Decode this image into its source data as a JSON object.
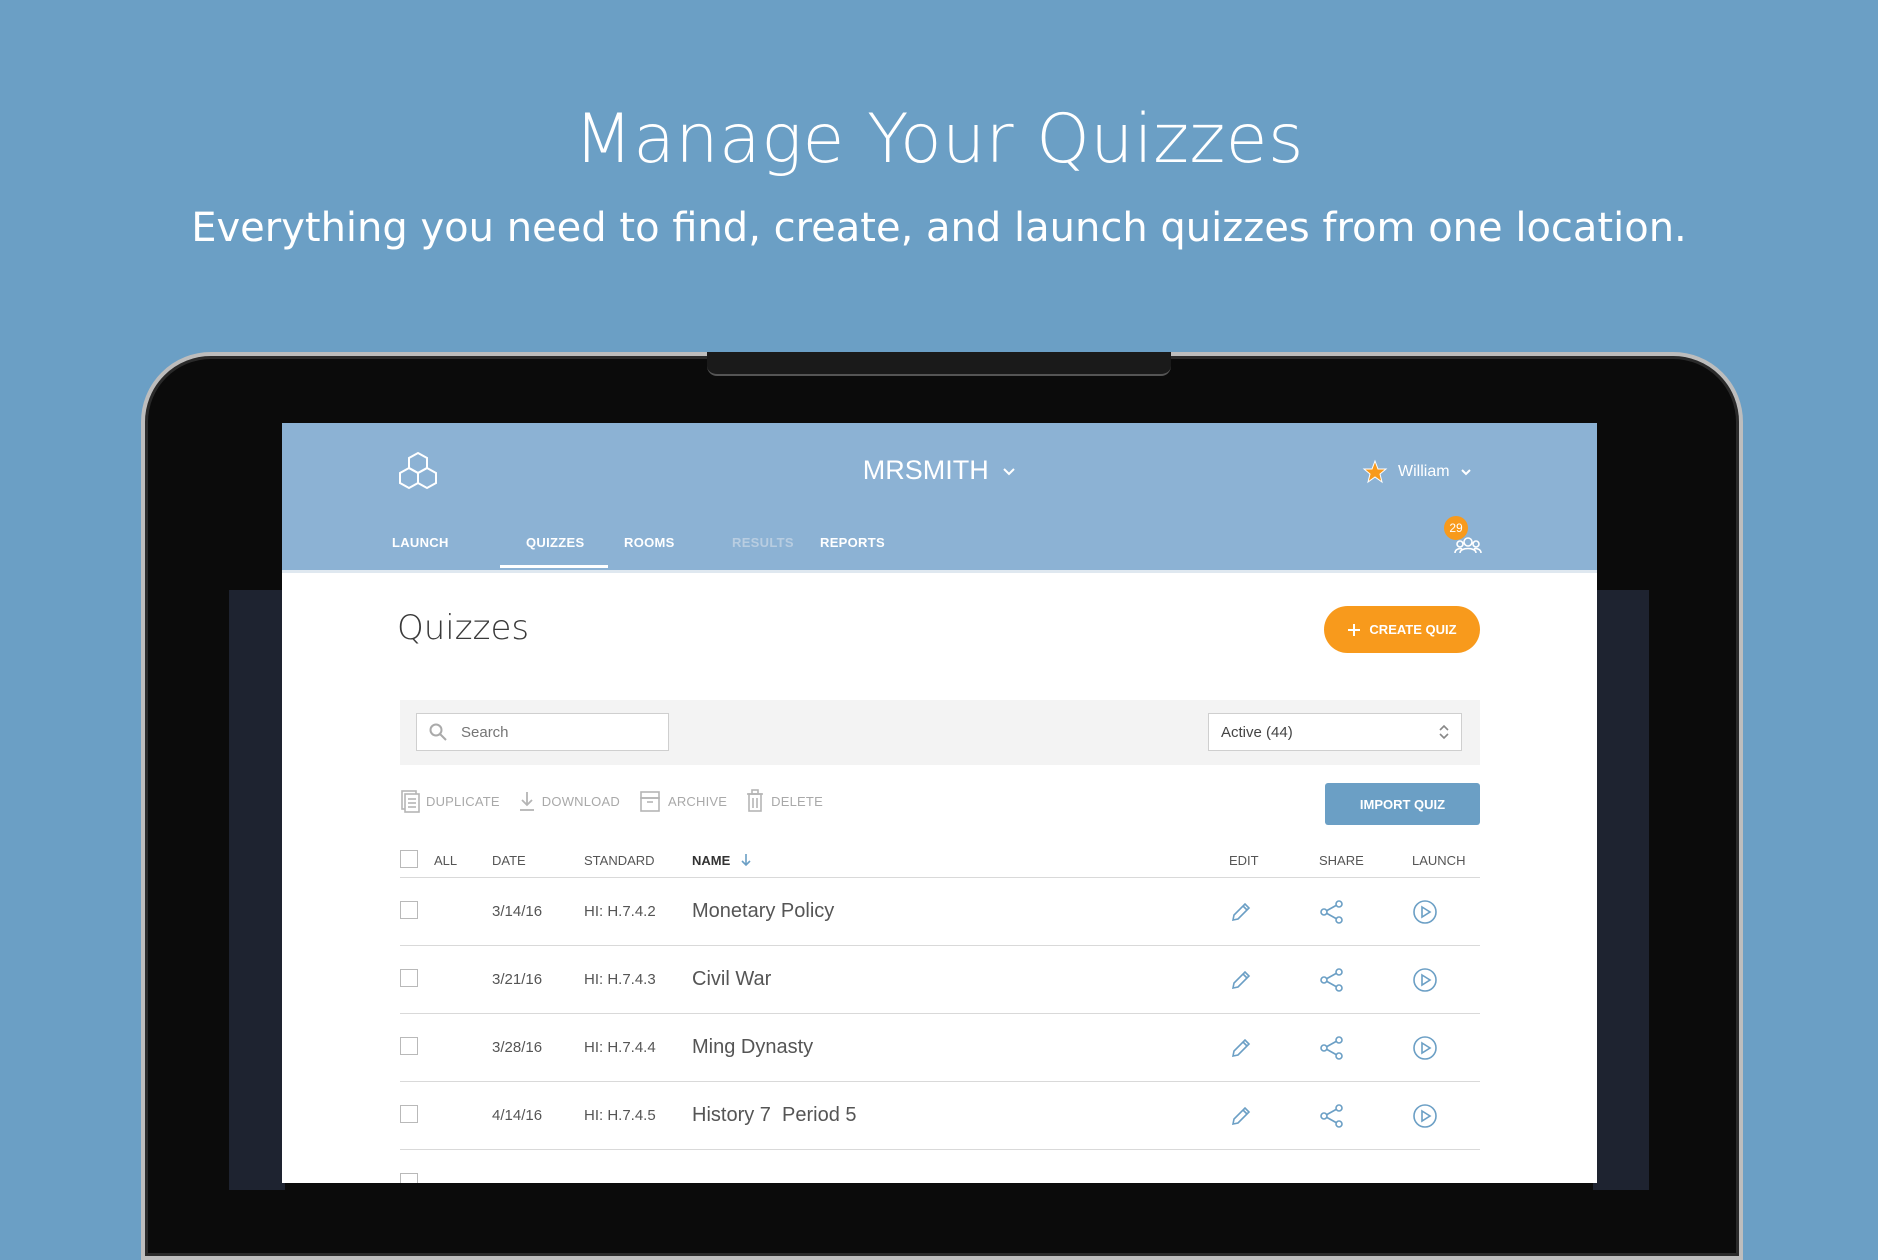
{
  "hero": {
    "title": "Manage Your Quizzes",
    "subtitle": "Everything you need to find, create, and launch quizzes from one location."
  },
  "header": {
    "account_name": "MRSMITH",
    "user_name": "William",
    "notification_count": "29",
    "tabs": [
      {
        "label": "LAUNCH",
        "state": "normal"
      },
      {
        "label": "QUIZZES",
        "state": "active"
      },
      {
        "label": "ROOMS",
        "state": "normal"
      },
      {
        "label": "RESULTS",
        "state": "disabled"
      },
      {
        "label": "REPORTS",
        "state": "normal"
      }
    ]
  },
  "main": {
    "page_title": "Quizzes",
    "create_button": "CREATE QUIZ",
    "search_placeholder": "Search",
    "filter_select": "Active",
    "filter_count": "(44)",
    "actions": [
      "DUPLICATE",
      "DOWNLOAD",
      "ARCHIVE",
      "DELETE"
    ],
    "import_button": "IMPORT QUIZ",
    "columns": {
      "all": "ALL",
      "date": "DATE",
      "standard": "STANDARD",
      "name": "NAME",
      "edit": "EDIT",
      "share": "SHARE",
      "launch": "LAUNCH"
    },
    "rows": [
      {
        "date": "3/14/16",
        "standard": "HI: H.7.4.2",
        "name": "Monetary Policy"
      },
      {
        "date": "3/21/16",
        "standard": "HI: H.7.4.3",
        "name": "Civil War"
      },
      {
        "date": "3/28/16",
        "standard": "HI: H.7.4.4",
        "name": "Ming Dynasty"
      },
      {
        "date": "4/14/16",
        "standard": "HI: H.7.4.5",
        "name": "History 7  Period 5"
      }
    ]
  },
  "colors": {
    "background": "#6b9fc5",
    "header": "#8cb2d4",
    "accent": "#f89a1c",
    "icon_blue": "#6b9fc5"
  },
  "icons": {
    "logo": "hexagon-logo-icon",
    "star": "star-icon",
    "chevron": "chevron-down-icon",
    "group": "group-icon",
    "plus": "plus-icon",
    "search": "search-icon",
    "sort": "arrow-down-icon",
    "edit": "pencil-icon",
    "share": "share-icon",
    "launch": "play-circle-icon"
  }
}
